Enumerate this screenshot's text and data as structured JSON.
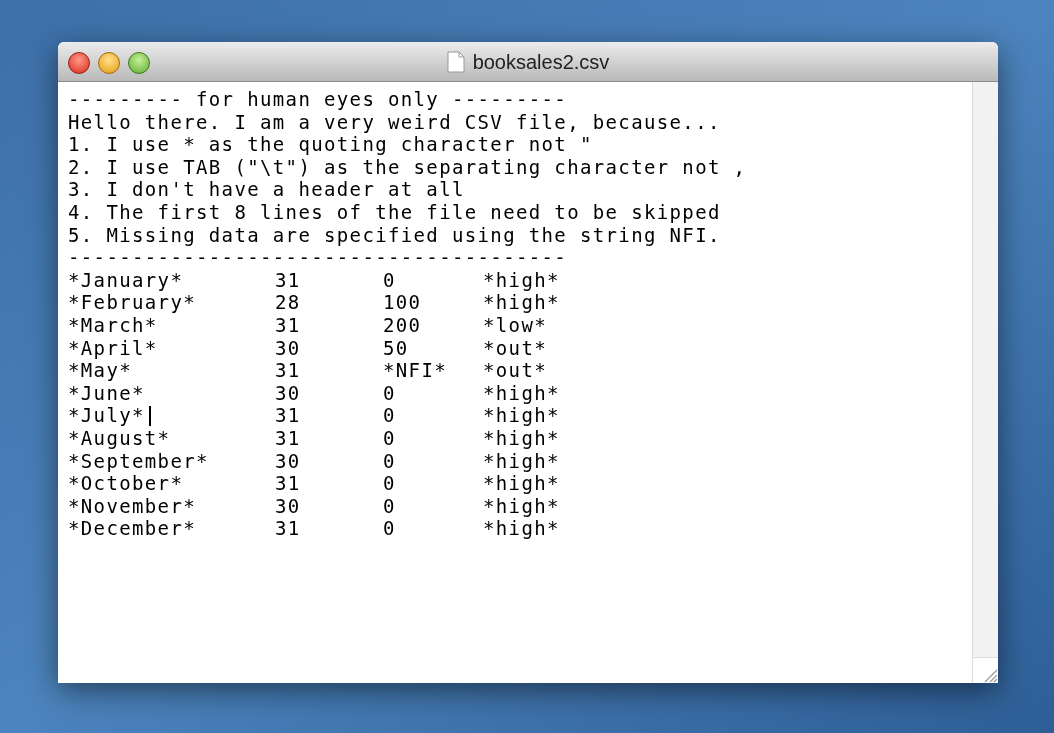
{
  "window": {
    "title": "booksales2.csv"
  },
  "preamble": [
    "--------- for human eyes only ---------",
    "Hello there. I am a very weird CSV file, because...",
    "1. I use * as the quoting character not \"",
    "2. I use TAB (\"\\t\") as the separating character not ,",
    "3. I don't have a header at all",
    "4. The first 8 lines of the file need to be skipped",
    "5. Missing data are specified using the string NFI.",
    "---------------------------------------"
  ],
  "rows": [
    {
      "cells": [
        "*January*",
        "31",
        "0",
        "*high*"
      ],
      "has_cursor": false
    },
    {
      "cells": [
        "*February*",
        "28",
        "100",
        "*high*"
      ],
      "has_cursor": false
    },
    {
      "cells": [
        "*March*",
        "31",
        "200",
        "*low*"
      ],
      "has_cursor": false
    },
    {
      "cells": [
        "*April*",
        "30",
        "50",
        "*out*"
      ],
      "has_cursor": false
    },
    {
      "cells": [
        "*May*",
        "31",
        "*NFI*",
        "*out*"
      ],
      "has_cursor": false
    },
    {
      "cells": [
        "*June*",
        "30",
        "0",
        "*high*"
      ],
      "has_cursor": false
    },
    {
      "cells": [
        "*July*",
        "31",
        "0",
        "*high*"
      ],
      "has_cursor": true
    },
    {
      "cells": [
        "*August*",
        "31",
        "0",
        "*high*"
      ],
      "has_cursor": false
    },
    {
      "cells": [
        "*September*",
        "30",
        "0",
        "*high*"
      ],
      "has_cursor": false
    },
    {
      "cells": [
        "*October*",
        "31",
        "0",
        "*high*"
      ],
      "has_cursor": false
    },
    {
      "cells": [
        "*November*",
        "30",
        "0",
        "*high*"
      ],
      "has_cursor": false
    },
    {
      "cells": [
        "*December*",
        "31",
        "0",
        "*high*"
      ],
      "has_cursor": false
    }
  ]
}
